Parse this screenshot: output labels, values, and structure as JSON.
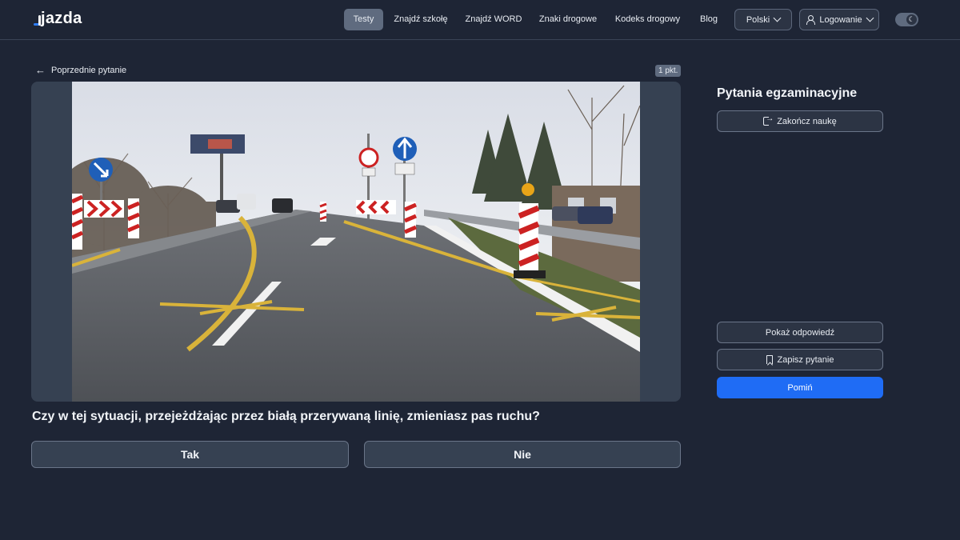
{
  "app": {
    "logo_text": "jazda"
  },
  "nav": {
    "items": [
      {
        "label": "Testy",
        "active": true
      },
      {
        "label": "Znajdź szkołę"
      },
      {
        "label": "Znajdź WORD"
      },
      {
        "label": "Znaki drogowe"
      },
      {
        "label": "Kodeks drogowy"
      },
      {
        "label": "Blog"
      }
    ],
    "language": "Polski",
    "login": "Logowanie",
    "theme_icon": "moon-icon"
  },
  "question": {
    "back_label": "Poprzednie pytanie",
    "points": "1 pkt.",
    "text": "Czy w tej sytuacji, przejeżdżając przez białą przerywaną linię, zmieniasz pas ruchu?",
    "answers": [
      "Tak",
      "Nie"
    ]
  },
  "sidebar": {
    "title": "Pytania egzaminacyjne",
    "finish_label": "Zakończ naukę",
    "show_answer_label": "Pokaż odpowiedź",
    "save_label": "Zapisz pytanie",
    "skip_label": "Pomiń"
  },
  "colors": {
    "background": "#1e2535",
    "accent": "#1f6cf5",
    "panel": "#364152"
  }
}
